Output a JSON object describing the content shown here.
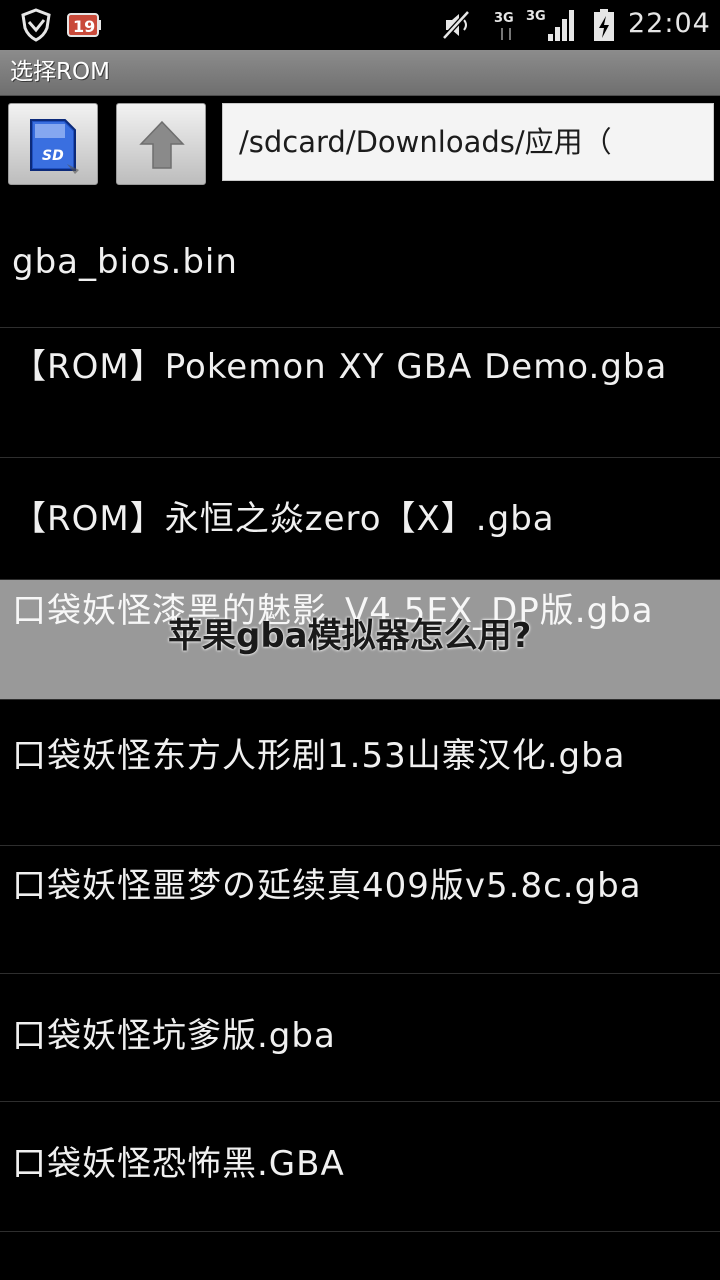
{
  "status_bar": {
    "time": "22:04",
    "network_1": "3G",
    "network_2": "3G",
    "icons": [
      "shield-icon",
      "battery-saver-icon",
      "mute-icon",
      "signal-3g-icon",
      "signal-3g-bars-icon",
      "battery-charging-icon"
    ]
  },
  "title_bar": {
    "title": "选择ROM"
  },
  "toolbar": {
    "sd_button_icon": "sd-card-icon",
    "up_button_icon": "arrow-up-icon",
    "path": "/sdcard/Downloads/应用（"
  },
  "files": [
    {
      "name": "gba_bios.bin",
      "selected": false
    },
    {
      "name": "【ROM】Pokemon XY GBA Demo.gba",
      "selected": false
    },
    {
      "name": "【ROM】永恒之焱zero【X】.gba",
      "selected": false
    },
    {
      "name": "口袋妖怪漆黑的魅影_V4.5EX_DP版.gba",
      "selected": true
    },
    {
      "name": "口袋妖怪东方人形剧1.53山寨汉化.gba",
      "selected": false
    },
    {
      "name": "口袋妖怪噩梦の延续真409版v5.8c.gba",
      "selected": false
    },
    {
      "name": "口袋妖怪坑爹版.gba",
      "selected": false
    },
    {
      "name": "口袋妖怪恐怖黑.GBA",
      "selected": false
    }
  ],
  "overlay": {
    "caption": "苹果gba模拟器怎么用?"
  },
  "colors": {
    "selected_row": "#999999",
    "background": "#000000",
    "title_bar": "#7d7d7d"
  }
}
